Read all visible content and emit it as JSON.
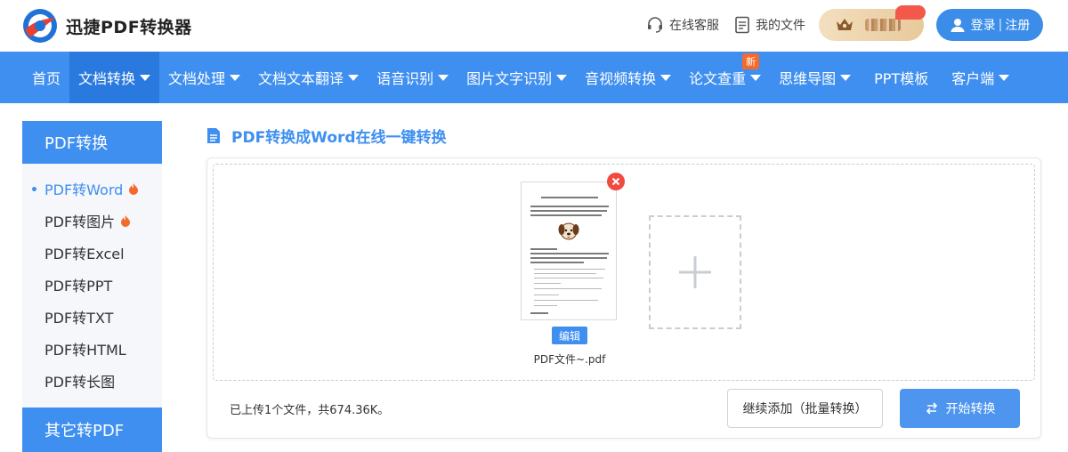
{
  "header": {
    "logo_text": "迅捷PDF转换器",
    "service_label": "在线客服",
    "files_label": "我的文件",
    "login_label": "登录",
    "register_label": "注册",
    "login_separator": "|"
  },
  "nav": {
    "items": [
      {
        "label": "首页",
        "dropdown": false
      },
      {
        "label": "文档转换",
        "dropdown": true,
        "active": true
      },
      {
        "label": "文档处理",
        "dropdown": true
      },
      {
        "label": "文档文本翻译",
        "dropdown": true
      },
      {
        "label": "语音识别",
        "dropdown": true
      },
      {
        "label": "图片文字识别",
        "dropdown": true
      },
      {
        "label": "音视频转换",
        "dropdown": true
      },
      {
        "label": "论文查重",
        "dropdown": true,
        "badge": "新"
      },
      {
        "label": "思维导图",
        "dropdown": true
      },
      {
        "label": "PPT模板",
        "dropdown": false
      },
      {
        "label": "客户端",
        "dropdown": true
      }
    ]
  },
  "sidebar": {
    "section_title": "PDF转换",
    "items": [
      {
        "label": "PDF转Word",
        "active": true,
        "hot": true
      },
      {
        "label": "PDF转图片",
        "hot": true
      },
      {
        "label": "PDF转Excel"
      },
      {
        "label": "PDF转PPT"
      },
      {
        "label": "PDF转TXT"
      },
      {
        "label": "PDF转HTML"
      },
      {
        "label": "PDF转长图"
      }
    ],
    "section2_title": "其它转PDF"
  },
  "main": {
    "title": "PDF转换成Word在线一键转换",
    "file": {
      "name": "PDF文件~.pdf",
      "edit_label": "编辑"
    },
    "status_text": "已上传1个文件，共674.36K。",
    "continue_label": "继续添加（批量转换）",
    "start_label": "开始转换"
  },
  "colors": {
    "primary": "#3f8ff0",
    "nav_active": "#2a79de",
    "danger": "#ef4b3f",
    "hot": "#f46a2c"
  },
  "icons": {
    "service": "headset-icon",
    "files": "document-icon",
    "user": "user-icon",
    "title": "file-icon",
    "remove": "close-icon",
    "add": "plus-icon",
    "start": "swap-arrows-icon",
    "hot": "fire-icon"
  }
}
